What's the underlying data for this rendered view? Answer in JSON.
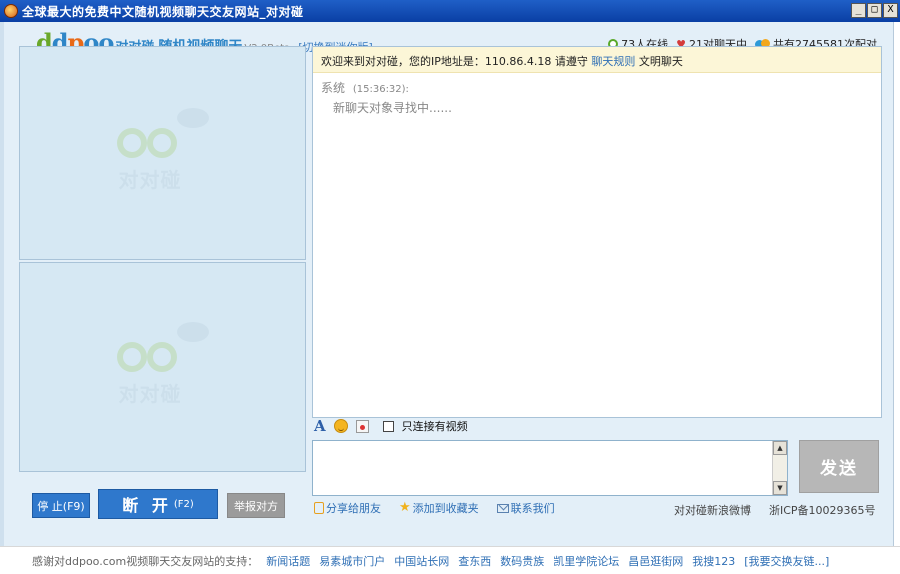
{
  "window": {
    "title": "全球最大的免费中文随机视频聊天交友网站_对对碰",
    "buttons": {
      "minimize": "_",
      "maximize": "□",
      "close": "X"
    }
  },
  "header": {
    "logo_ddpoo": [
      "d",
      "d",
      "p",
      "oo"
    ],
    "logo_cn": "对对碰",
    "slogan": "随机视频聊天",
    "version": "V2.0Beta",
    "mini_link": "[切换到迷你版]",
    "stats": {
      "online": "73人在线",
      "chatting": "21对聊天中",
      "matched": "共有2745581次配对"
    }
  },
  "video": {
    "watermark": "对对碰"
  },
  "chat": {
    "notice_prefix": "欢迎来到对对碰，您的IP地址是：110.86.4.18    请遵守",
    "notice_link": "聊天规则",
    "notice_suffix": "文明聊天",
    "messages": [
      {
        "sender": "系统",
        "time": "(15:36:32):",
        "text": "新聊天对象寻找中......"
      }
    ]
  },
  "toolbar": {
    "font_glyph": "A",
    "video_only_label": "只连接有视频"
  },
  "input": {
    "value": ""
  },
  "buttons": {
    "send": "发送",
    "stop": "停 止(F9)",
    "disconnect_main": "断 开",
    "disconnect_key": "(F2)",
    "report": "举报对方"
  },
  "share": {
    "share_friends": "分享给朋友",
    "add_favorite": "添加到收藏夹",
    "contact_us": "联系我们",
    "weibo": "对对碰新浪微博",
    "icp": "浙ICP备10029365号"
  },
  "footer": {
    "thanks": "感谢对ddpoo.com视频聊天交友网站的支持：",
    "links": [
      "新闻话题",
      "易素城市门户",
      "中国站长网",
      "查东西",
      "数码贵族",
      "凯里学院论坛",
      "昌邑逛街网",
      "我搜123",
      "[我要交换友链...]"
    ]
  }
}
